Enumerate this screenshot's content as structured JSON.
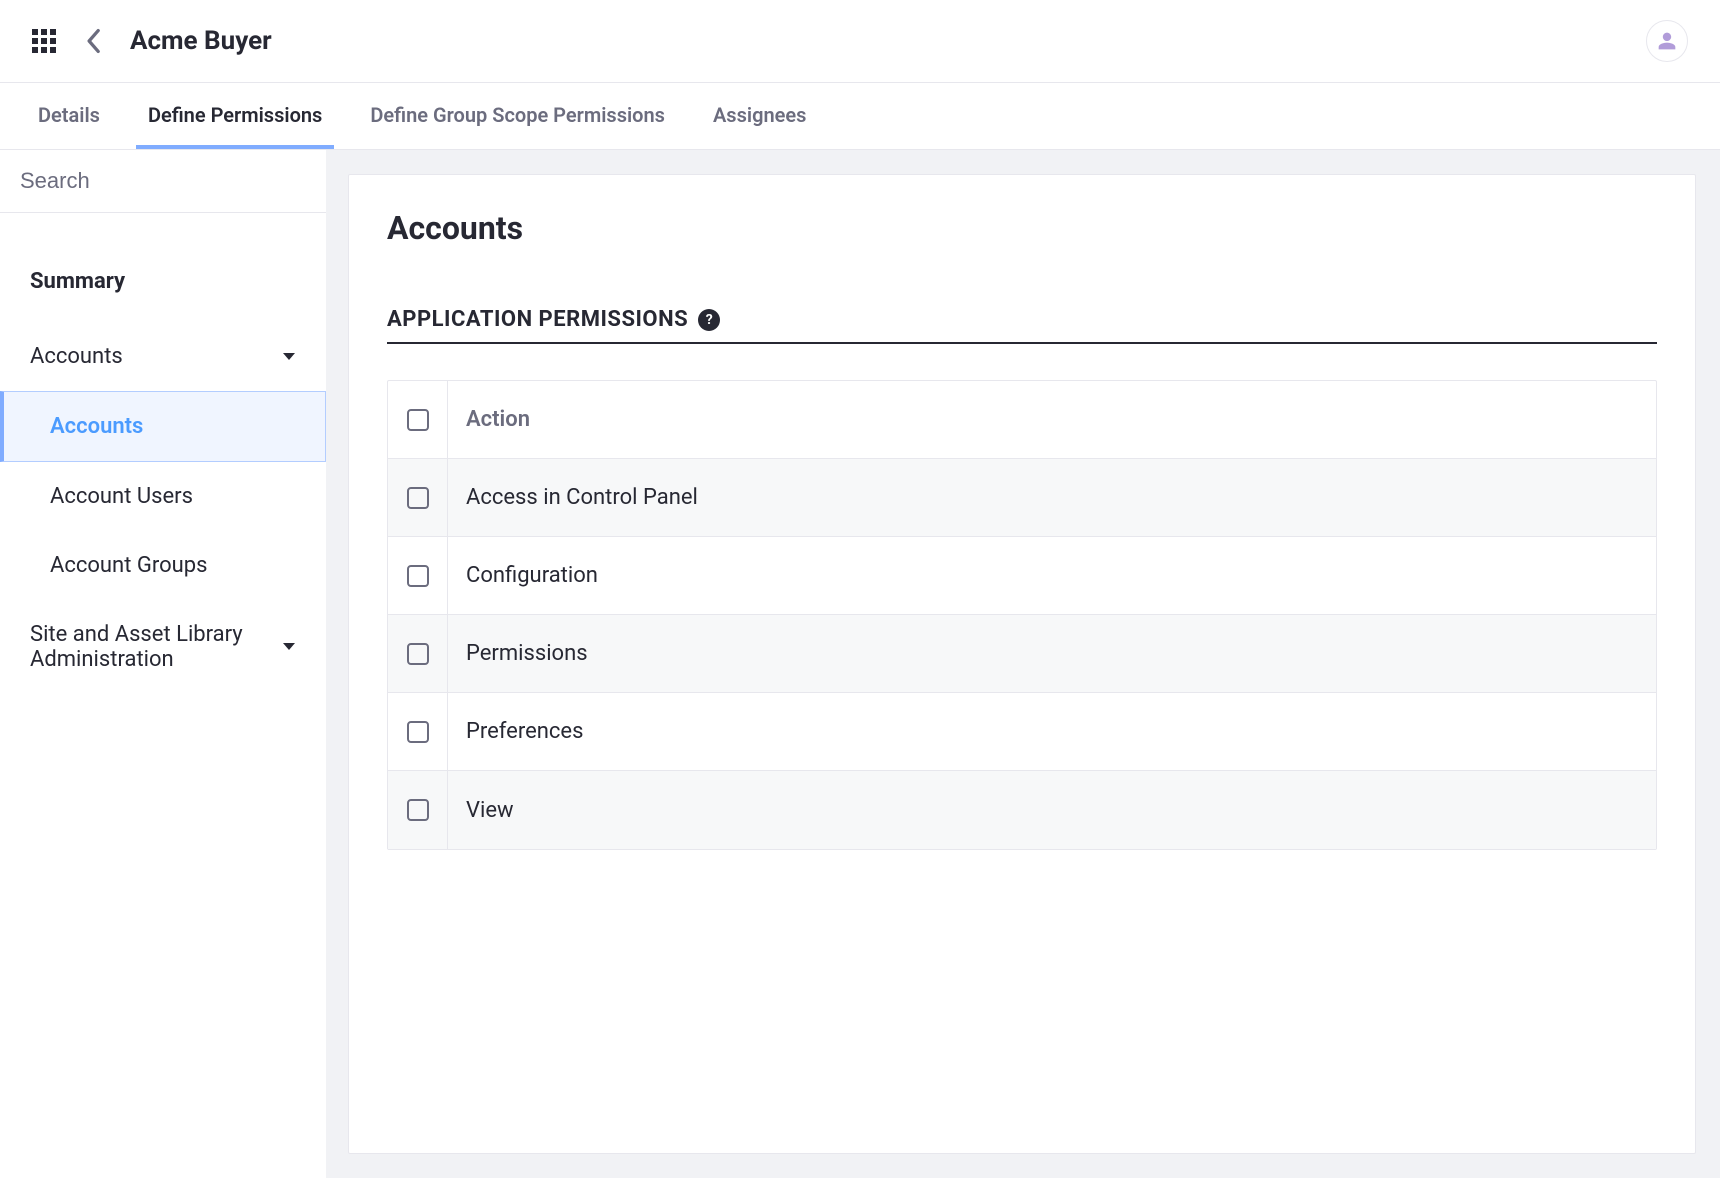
{
  "header": {
    "title": "Acme Buyer"
  },
  "tabs": [
    {
      "id": "details",
      "label": "Details",
      "active": false
    },
    {
      "id": "define-permissions",
      "label": "Define Permissions",
      "active": true
    },
    {
      "id": "define-group-scope",
      "label": "Define Group Scope Permissions",
      "active": false
    },
    {
      "id": "assignees",
      "label": "Assignees",
      "active": false
    }
  ],
  "sidebar": {
    "search_placeholder": "Search",
    "summary_label": "Summary",
    "categories": [
      {
        "id": "accounts",
        "label": "Accounts",
        "expanded": true,
        "items": [
          {
            "id": "accounts-sub",
            "label": "Accounts",
            "active": true
          },
          {
            "id": "account-users",
            "label": "Account Users",
            "active": false
          },
          {
            "id": "account-groups",
            "label": "Account Groups",
            "active": false
          }
        ]
      },
      {
        "id": "site-asset-admin",
        "label": "Site and Asset Library Administration",
        "expanded": false,
        "items": []
      }
    ]
  },
  "main": {
    "panel_title": "Accounts",
    "section_heading": "APPLICATION PERMISSIONS",
    "table_header": "Action",
    "permissions": [
      {
        "id": "access-control-panel",
        "label": "Access in Control Panel",
        "alt": true
      },
      {
        "id": "configuration",
        "label": "Configuration",
        "alt": false
      },
      {
        "id": "permissions",
        "label": "Permissions",
        "alt": true
      },
      {
        "id": "preferences",
        "label": "Preferences",
        "alt": false
      },
      {
        "id": "view",
        "label": "View",
        "alt": true
      }
    ]
  }
}
